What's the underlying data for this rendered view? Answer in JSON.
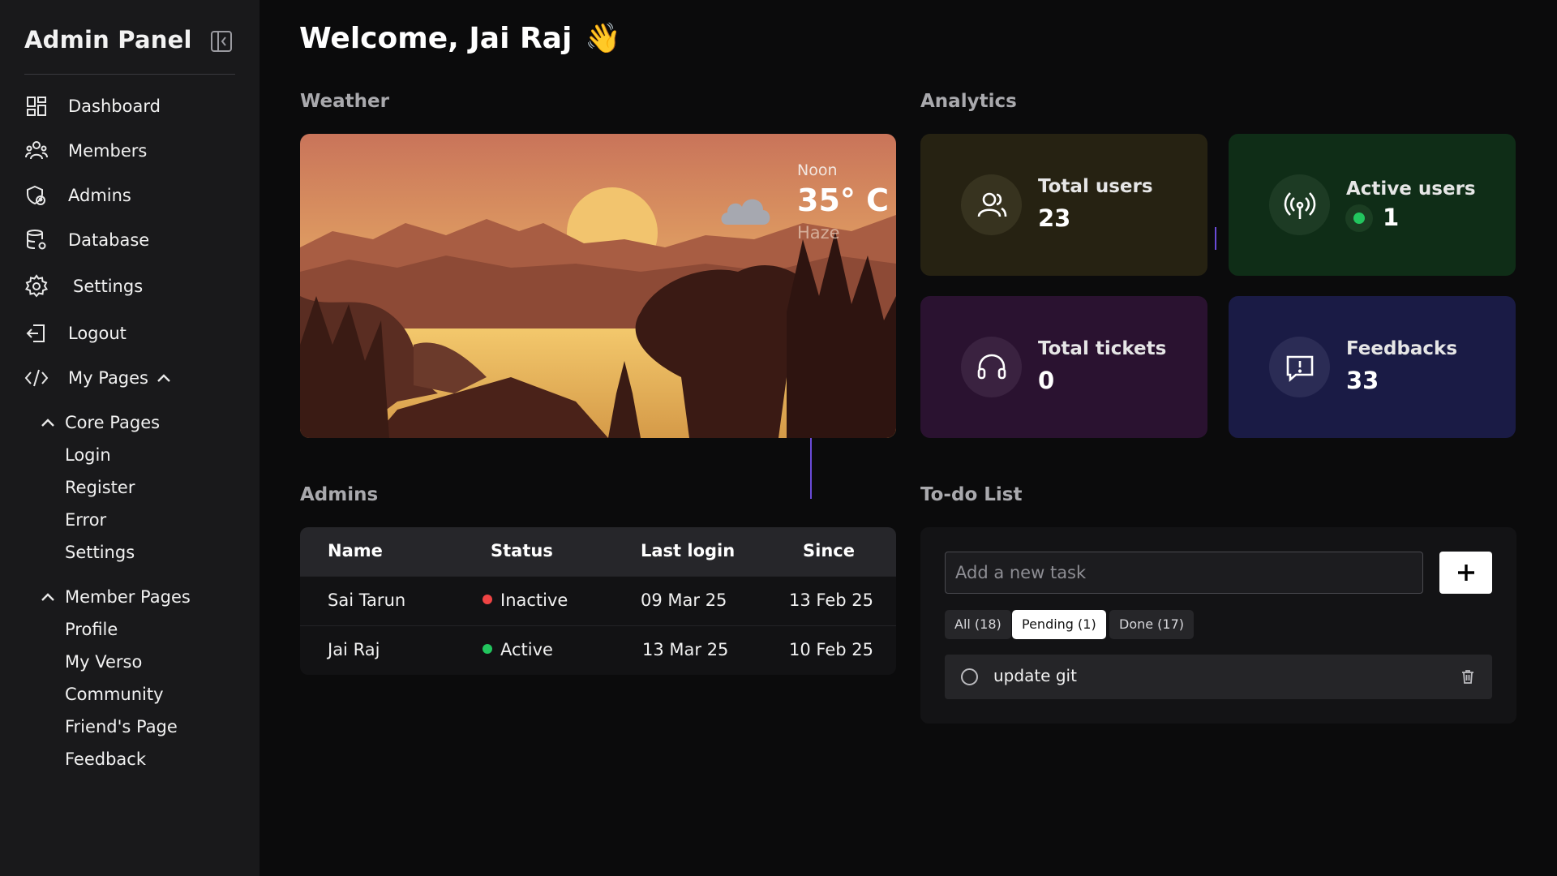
{
  "sidebar": {
    "brand": "Admin Panel",
    "nav": [
      {
        "label": "Dashboard",
        "icon": "dashboard-grid-icon"
      },
      {
        "label": "Members",
        "icon": "members-icon"
      },
      {
        "label": "Admins",
        "icon": "admin-shield-icon"
      },
      {
        "label": "Database",
        "icon": "database-icon"
      },
      {
        "label": "Settings",
        "icon": "gear-icon"
      },
      {
        "label": "Logout",
        "icon": "logout-icon"
      },
      {
        "label": "My Pages",
        "icon": "code-icon"
      }
    ],
    "core_pages": {
      "label": "Core Pages",
      "items": [
        "Login",
        "Register",
        "Error",
        "Settings"
      ]
    },
    "member_pages": {
      "label": "Member Pages",
      "items": [
        "Profile",
        "My Verso",
        "Community",
        "Friend's Page",
        "Feedback"
      ]
    }
  },
  "header": {
    "welcome": "Welcome, Jai Raj",
    "wave_emoji": "👋"
  },
  "weather": {
    "section_title": "Weather",
    "time_of_day": "Noon",
    "temperature": "35° C",
    "condition": "Haze"
  },
  "analytics": {
    "section_title": "Analytics",
    "cards": [
      {
        "label": "Total users",
        "value": "23",
        "icon": "users-icon",
        "bg": "#262212"
      },
      {
        "label": "Active users",
        "value": "1",
        "icon": "broadcast-icon",
        "bg": "#0f2d17"
      },
      {
        "label": "Total tickets",
        "value": "0",
        "icon": "headset-icon",
        "bg": "#2a1230"
      },
      {
        "label": "Feedbacks",
        "value": "33",
        "icon": "message-alert-icon",
        "bg": "#1a1b45"
      }
    ]
  },
  "admins": {
    "section_title": "Admins",
    "columns": [
      "Name",
      "Status",
      "Last login",
      "Since"
    ],
    "rows": [
      {
        "name": "Sai Tarun",
        "status": "Inactive",
        "status_color": "#ef4444",
        "last_login": "09 Mar 25",
        "since": "13 Feb 25"
      },
      {
        "name": "Jai Raj",
        "status": "Active",
        "status_color": "#22c55e",
        "last_login": "13 Mar 25",
        "since": "10 Feb 25"
      }
    ]
  },
  "todo": {
    "section_title": "To-do List",
    "placeholder": "Add a new task",
    "filters": [
      {
        "label": "All (18)",
        "active": false
      },
      {
        "label": "Pending (1)",
        "active": true
      },
      {
        "label": "Done (17)",
        "active": false
      }
    ],
    "items": [
      {
        "text": "update git",
        "done": false
      }
    ]
  },
  "colors": {
    "sidebar_bg": "#19191b",
    "page_bg": "#0b0b0c",
    "accent_purple": "#6a4bd8"
  }
}
